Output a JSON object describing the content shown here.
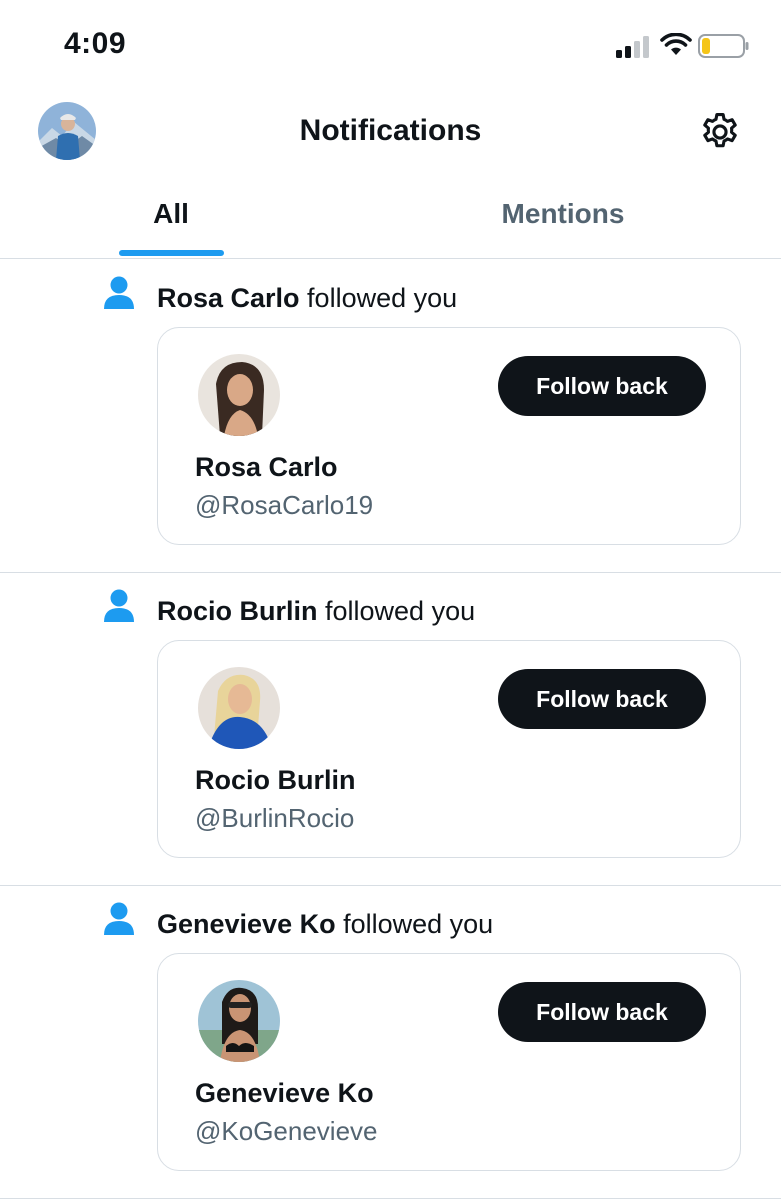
{
  "status_bar": {
    "time": "4:09",
    "signal_icon": "cellular-signal-icon",
    "wifi_icon": "wifi-icon",
    "battery_icon": "battery-low-icon",
    "battery_level": 0.2,
    "battery_color": "#f5c518"
  },
  "header": {
    "title": "Notifications",
    "avatar_icon": "profile-avatar",
    "settings_icon": "gear-icon"
  },
  "tabs": [
    {
      "label": "All",
      "active": true
    },
    {
      "label": "Mentions",
      "active": false
    }
  ],
  "colors": {
    "accent": "#1d9bf0",
    "button_bg": "#0f1419",
    "muted_text": "#536471",
    "border": "#d8dee4"
  },
  "notifications": [
    {
      "name": "Rosa Carlo",
      "action": " followed you",
      "card_name": "Rosa Carlo",
      "handle": "@RosaCarlo19",
      "button_label": "Follow back"
    },
    {
      "name": "Rocio Burlin",
      "action": " followed you",
      "card_name": "Rocio Burlin",
      "handle": "@BurlinRocio",
      "button_label": "Follow back"
    },
    {
      "name": "Genevieve Ko",
      "action": " followed you",
      "card_name": "Genevieve Ko",
      "handle": "@KoGenevieve",
      "button_label": "Follow back"
    }
  ]
}
